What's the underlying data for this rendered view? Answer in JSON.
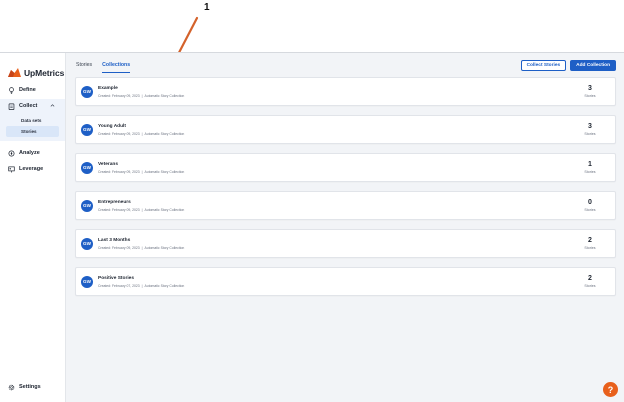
{
  "annotation": {
    "label": "1"
  },
  "brand": {
    "name": "UpMetrics",
    "mark_color": "#e8601c"
  },
  "sidebar": {
    "items": [
      {
        "label": "Define",
        "icon": "lightbulb-icon"
      },
      {
        "label": "Collect",
        "icon": "clipboard-icon",
        "expanded": true,
        "children": [
          {
            "label": "Data sets"
          },
          {
            "label": "Stories"
          }
        ]
      },
      {
        "label": "Analyze",
        "icon": "compass-icon"
      },
      {
        "label": "Leverage",
        "icon": "presentation-icon"
      }
    ],
    "settings_label": "Settings"
  },
  "topbar": {
    "tabs": [
      {
        "label": "Stories"
      },
      {
        "label": "Collections",
        "active": true
      }
    ],
    "collect_button": "Collect Stories",
    "add_button": "Add Collection"
  },
  "collections": [
    {
      "avatar": "GW",
      "title": "Example",
      "created": "Created: February 09, 2023",
      "type": "Automatic Story Collection",
      "count": "3",
      "count_label": "Stories"
    },
    {
      "avatar": "GW",
      "title": "Young Adult",
      "created": "Created: February 09, 2023",
      "type": "Automatic Story Collection",
      "count": "3",
      "count_label": "Stories"
    },
    {
      "avatar": "GW",
      "title": "Veterans",
      "created": "Created: February 09, 2023",
      "type": "Automatic Story Collection",
      "count": "1",
      "count_label": "Stories"
    },
    {
      "avatar": "GW",
      "title": "Entrepreneurs",
      "created": "Created: February 09, 2023",
      "type": "Automatic Story Collection",
      "count": "0",
      "count_label": "Stories"
    },
    {
      "avatar": "GW",
      "title": "Last 3 Months",
      "created": "Created: February 09, 2023",
      "type": "Automatic Story Collection",
      "count": "2",
      "count_label": "Stories"
    },
    {
      "avatar": "GW",
      "title": "Positive Stories",
      "created": "Created: February 07, 2023",
      "type": "Automatic Story Collection",
      "count": "2",
      "count_label": "Stories"
    }
  ],
  "help": {
    "label": "?",
    "color": "#e8601c"
  },
  "colors": {
    "accent": "#1e5fc6",
    "annotation_line": "#d4622b"
  }
}
